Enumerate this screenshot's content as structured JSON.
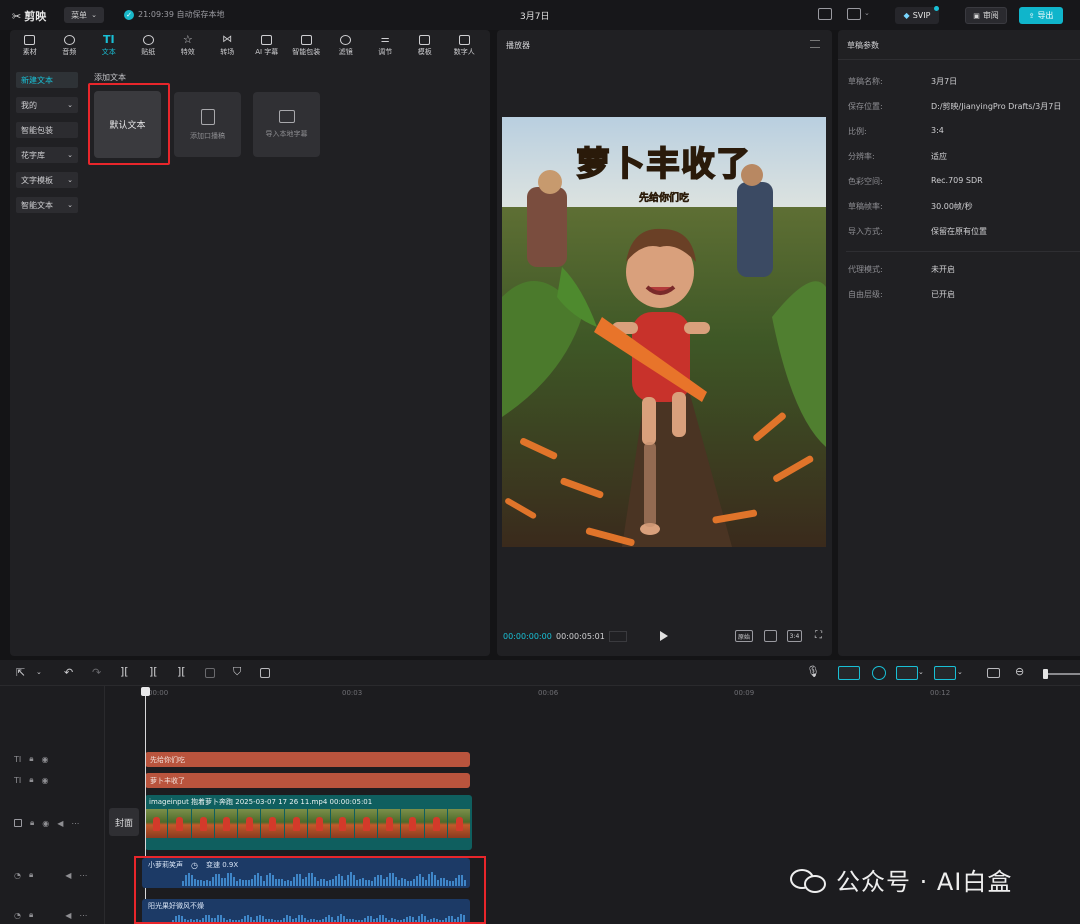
{
  "app": {
    "name": "剪映",
    "menu_label": "菜单",
    "autosave_text": "21:09:39 自动保存本地",
    "project_title": "3月7日",
    "svip_label": "SVIP",
    "review_label": "审阅",
    "export_label": "导出"
  },
  "tool_tabs": [
    {
      "label": "素材",
      "icon": "media-icon"
    },
    {
      "label": "音频",
      "icon": "audio-icon"
    },
    {
      "label": "文本",
      "icon": "text-icon"
    },
    {
      "label": "贴纸",
      "icon": "sticker-icon"
    },
    {
      "label": "特效",
      "icon": "effects-icon"
    },
    {
      "label": "转场",
      "icon": "transition-icon"
    },
    {
      "label": "AI 字幕",
      "icon": "ai-subtitle-icon"
    },
    {
      "label": "智能包装",
      "icon": "smart-pack-icon"
    },
    {
      "label": "滤镜",
      "icon": "filter-icon"
    },
    {
      "label": "调节",
      "icon": "adjust-icon"
    },
    {
      "label": "模板",
      "icon": "template-icon"
    },
    {
      "label": "数字人",
      "icon": "digital-human-icon"
    }
  ],
  "active_tab": "文本",
  "sidebar": [
    {
      "label": "新建文本",
      "chevron": false,
      "active": true
    },
    {
      "label": "我的",
      "chevron": true
    },
    {
      "label": "智能包装",
      "chevron": false
    },
    {
      "label": "花字库",
      "chevron": true
    },
    {
      "label": "文字模板",
      "chevron": true
    },
    {
      "label": "智能文本",
      "chevron": true
    }
  ],
  "text_panel": {
    "section_label": "添加文本",
    "default_card": "默认文本",
    "cards": [
      {
        "label": "添加口播稿",
        "icon": "script-icon"
      },
      {
        "label": "导入本地字幕",
        "icon": "folder-icon"
      }
    ]
  },
  "player": {
    "title": "播放器",
    "overlay_title": "萝卜丰收了",
    "overlay_subtitle": "先给你们吃",
    "current_time": "00:00:00:00",
    "total_time": "00:00:05:01",
    "ratio_label": "3:4",
    "full_label": "原始"
  },
  "properties": {
    "title": "草稿参数",
    "rows": [
      {
        "label": "草稿名称:",
        "value": "3月7日"
      },
      {
        "label": "保存位置:",
        "value": "D:/剪映/JianyingPro Drafts/3月7日"
      },
      {
        "label": "比例:",
        "value": "3:4"
      },
      {
        "label": "分辨率:",
        "value": "适应"
      },
      {
        "label": "色彩空间:",
        "value": "Rec.709 SDR"
      },
      {
        "label": "草稿帧率:",
        "value": "30.00帧/秒"
      },
      {
        "label": "导入方式:",
        "value": "保留在原有位置"
      }
    ],
    "rows2": [
      {
        "label": "代理模式:",
        "value": "未开启"
      },
      {
        "label": "自由层级:",
        "value": "已开启"
      }
    ]
  },
  "timeline": {
    "ticks": [
      "00:00",
      "00:03",
      "00:06",
      "00:09",
      "00:12"
    ],
    "text_clips": [
      "先给你们吃",
      "萝卜丰收了"
    ],
    "video_clip_label": "imageinput 抱着萝卜奔跑 2025-03-07 17 26 11.mp4   00:00:05:01",
    "cover_label": "封面",
    "audio_clips": [
      {
        "label": "小萝莉笑声",
        "speed": "变速 0.9X"
      },
      {
        "label": "阳光果好微风不燥",
        "speed": ""
      }
    ]
  },
  "watermark": {
    "text": "公众号 · AI白盒"
  },
  "colors": {
    "accent": "#19c0d6",
    "highlight_red": "#e8262b",
    "text_clip": "#b9543d",
    "video_clip": "#0f5f5f",
    "audio_clip": "#1c3a66"
  }
}
